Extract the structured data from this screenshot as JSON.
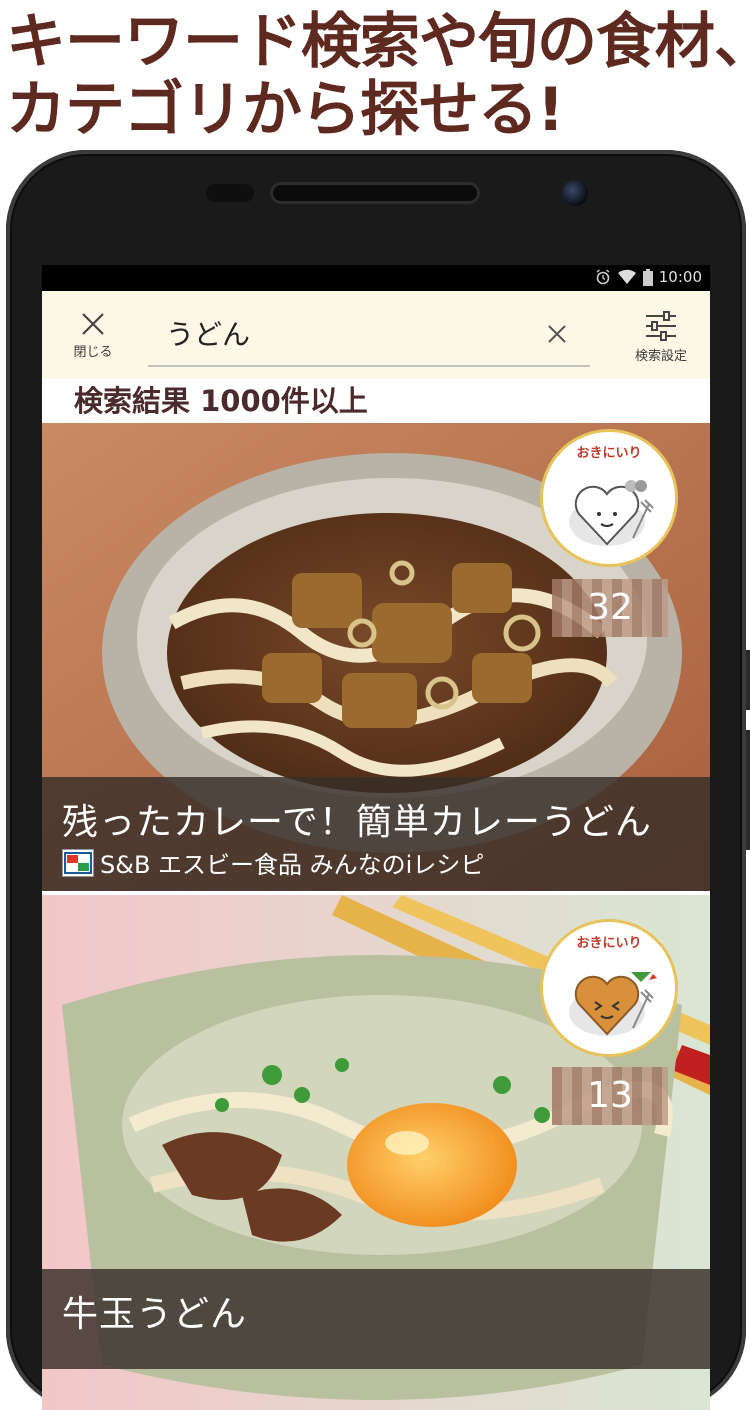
{
  "headline": {
    "line1": "キーワード検索や旬の食材、",
    "line2": "カテゴリから探せる!"
  },
  "status_bar": {
    "time": "10:00",
    "icons": [
      "alarm-icon",
      "wifi-icon",
      "battery-icon"
    ]
  },
  "header": {
    "close_label": "閉じる",
    "search_value": "うどん",
    "settings_label": "検索設定"
  },
  "result_count": "検索結果 1000件以上",
  "recipes": [
    {
      "title": "残ったカレーで！簡単カレーうどん",
      "source": "S&B エスビー食品 みんなのiレシピ",
      "badge": "おきにいり",
      "count": "32"
    },
    {
      "title": "牛玉うどん",
      "badge": "おきにいり",
      "count": "13"
    }
  ],
  "colors": {
    "headline": "#5e2a20",
    "header_bg": "#fdf7e6",
    "badge_border": "#e8c25a"
  }
}
